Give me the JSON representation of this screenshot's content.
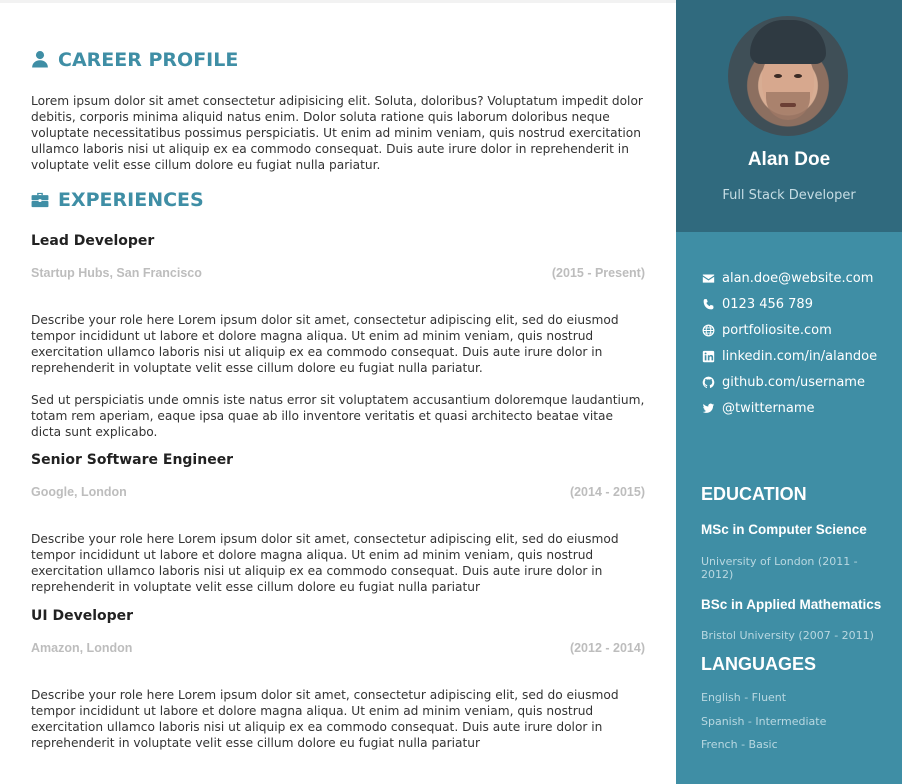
{
  "profile": {
    "name": "Alan Doe",
    "tagline": "Full Stack Developer"
  },
  "contact": [
    {
      "icon": "envelope-icon",
      "text": "alan.doe@website.com"
    },
    {
      "icon": "phone-icon",
      "text": "0123 456 789"
    },
    {
      "icon": "globe-icon",
      "text": "portfoliosite.com"
    },
    {
      "icon": "linkedin-icon",
      "text": "linkedin.com/in/alandoe"
    },
    {
      "icon": "github-icon",
      "text": "github.com/username"
    },
    {
      "icon": "twitter-icon",
      "text": "@twittername"
    }
  ],
  "education": {
    "title": "EDUCATION",
    "items": [
      {
        "degree": "MSc in Computer Science",
        "school": "University of London (2011 - 2012)"
      },
      {
        "degree": "BSc in Applied Mathematics",
        "school": "Bristol University (2007 - 2011)"
      }
    ]
  },
  "languages": {
    "title": "LANGUAGES",
    "items": [
      "English - Fluent",
      "Spanish - Intermediate",
      "French - Basic"
    ]
  },
  "career": {
    "title": "CAREER PROFILE",
    "summary": "Lorem ipsum dolor sit amet consectetur adipisicing elit. Soluta, doloribus? Voluptatum impedit dolor debitis, corporis minima aliquid natus enim. Dolor soluta ratione quis laborum doloribus neque voluptate necessitatibus possimus perspiciatis. Ut enim ad minim veniam, quis nostrud exercitation ullamco laboris nisi ut aliquip ex ea commodo consequat. Duis aute irure dolor in reprehenderit in voluptate velit esse cillum dolore eu fugiat nulla pariatur."
  },
  "experiences": {
    "title": "EXPERIENCES",
    "items": [
      {
        "role": "Lead Developer",
        "company": "Startup Hubs, San Francisco",
        "dates": "(2015 - Present)",
        "desc1": "Describe your role here Lorem ipsum dolor sit amet, consectetur adipiscing elit, sed do eiusmod tempor incididunt ut labore et dolore magna aliqua. Ut enim ad minim veniam, quis nostrud exercitation ullamco laboris nisi ut aliquip ex ea commodo consequat. Duis aute irure dolor in reprehenderit in voluptate velit esse cillum dolore eu fugiat nulla pariatur.",
        "desc2": "Sed ut perspiciatis unde omnis iste natus error sit voluptatem accusantium doloremque laudantium, totam rem aperiam, eaque ipsa quae ab illo inventore veritatis et quasi architecto beatae vitae dicta sunt explicabo."
      },
      {
        "role": "Senior Software Engineer",
        "company": "Google, London",
        "dates": "(2014 - 2015)",
        "desc1": "Describe your role here Lorem ipsum dolor sit amet, consectetur adipiscing elit, sed do eiusmod tempor incididunt ut labore et dolore magna aliqua. Ut enim ad minim veniam, quis nostrud exercitation ullamco laboris nisi ut aliquip ex ea commodo consequat. Duis aute irure dolor in reprehenderit in voluptate velit esse cillum dolore eu fugiat nulla pariatur"
      },
      {
        "role": "UI Developer",
        "company": "Amazon, London",
        "dates": "(2012 - 2014)",
        "desc1": "Describe your role here Lorem ipsum dolor sit amet, consectetur adipiscing elit, sed do eiusmod tempor incididunt ut labore et dolore magna aliqua. Ut enim ad minim veniam, quis nostrud exercitation ullamco laboris nisi ut aliquip ex ea commodo consequat. Duis aute irure dolor in reprehenderit in voluptate velit esse cillum dolore eu fugiat nulla pariatur"
      }
    ]
  },
  "colors": {
    "accent": "#3f8ea5",
    "sidebar_dark": "#306a7e",
    "meta_gray": "#bdbdbd"
  }
}
